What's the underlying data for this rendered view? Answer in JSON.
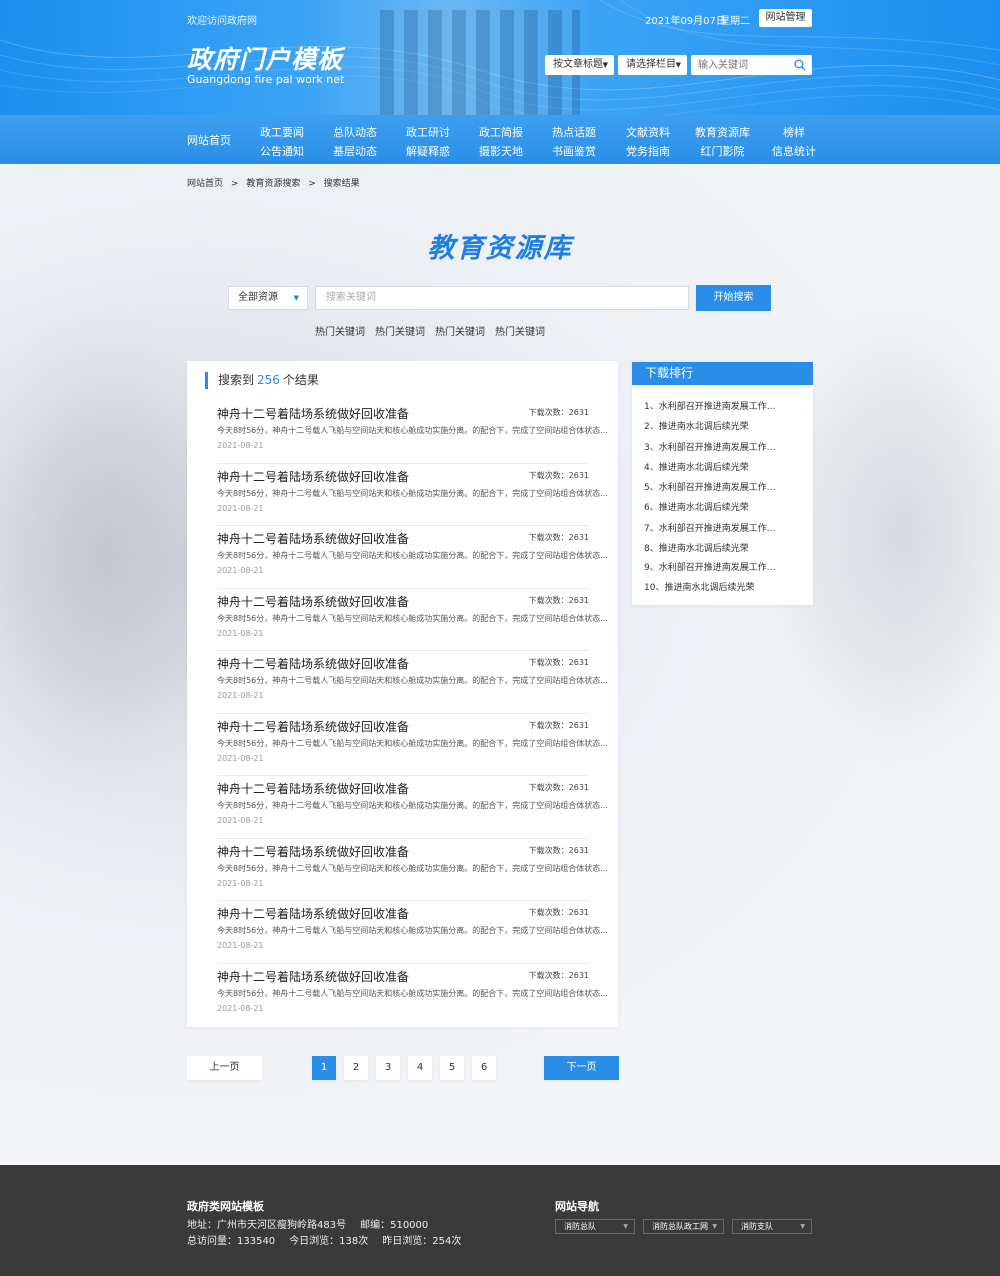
{
  "header": {
    "welcome": "欢迎访问政府网",
    "date": "2021年09月07日",
    "weekday": "星期二",
    "admin_label": "网站管理",
    "logo_title": "政府门户模板",
    "logo_sub": "Guangdong fire pal work net",
    "select1": "按文章标题",
    "select2": "请选择栏目",
    "search_placeholder": "输入关键词"
  },
  "nav": {
    "home": "网站首页",
    "columns": [
      [
        "政工要闻",
        "公告通知"
      ],
      [
        "总队动态",
        "基层动态"
      ],
      [
        "政工研讨",
        "解疑释惑"
      ],
      [
        "政工简报",
        "摄影天地"
      ],
      [
        "热点话题",
        "书画鉴赏"
      ],
      [
        "文献资料",
        "党务指南"
      ],
      [
        "教育资源库",
        "红门影院"
      ],
      [
        "榜样",
        "信息统计"
      ]
    ]
  },
  "breadcrumb": [
    "网站首页",
    ">",
    "教育资源搜索",
    ">",
    "搜索结果"
  ],
  "main": {
    "title": "教育资源库",
    "resource_select": "全部资源",
    "search_placeholder": "搜索关键词",
    "search_button": "开始搜索",
    "hot_keywords": [
      "热门关键词",
      "热门关键词",
      "热门关键词",
      "热门关键词"
    ]
  },
  "results": {
    "prefix": "搜索到",
    "count": "256",
    "suffix": "个结果",
    "items": [
      {
        "title": "神舟十二号着陆场系统做好回收准备",
        "downloads": "下载次数：2631",
        "summary": "今天8时56分，神舟十二号载人飞船与空间站天和核心舱成功实施分离。的配合下，完成了空间站组合体状态...",
        "date": "2021-08-21"
      },
      {
        "title": "神舟十二号着陆场系统做好回收准备",
        "downloads": "下载次数：2631",
        "summary": "今天8时56分，神舟十二号载人飞船与空间站天和核心舱成功实施分离。的配合下，完成了空间站组合体状态...",
        "date": "2021-08-21"
      },
      {
        "title": "神舟十二号着陆场系统做好回收准备",
        "downloads": "下载次数：2631",
        "summary": "今天8时56分，神舟十二号载人飞船与空间站天和核心舱成功实施分离。的配合下，完成了空间站组合体状态...",
        "date": "2021-08-21"
      },
      {
        "title": "神舟十二号着陆场系统做好回收准备",
        "downloads": "下载次数：2631",
        "summary": "今天8时56分，神舟十二号载人飞船与空间站天和核心舱成功实施分离。的配合下，完成了空间站组合体状态...",
        "date": "2021-08-21"
      },
      {
        "title": "神舟十二号着陆场系统做好回收准备",
        "downloads": "下载次数：2631",
        "summary": "今天8时56分，神舟十二号载人飞船与空间站天和核心舱成功实施分离。的配合下，完成了空间站组合体状态...",
        "date": "2021-08-21"
      },
      {
        "title": "神舟十二号着陆场系统做好回收准备",
        "downloads": "下载次数：2631",
        "summary": "今天8时56分，神舟十二号载人飞船与空间站天和核心舱成功实施分离。的配合下，完成了空间站组合体状态...",
        "date": "2021-08-21"
      },
      {
        "title": "神舟十二号着陆场系统做好回收准备",
        "downloads": "下载次数：2631",
        "summary": "今天8时56分，神舟十二号载人飞船与空间站天和核心舱成功实施分离。的配合下，完成了空间站组合体状态...",
        "date": "2021-08-21"
      },
      {
        "title": "神舟十二号着陆场系统做好回收准备",
        "downloads": "下载次数：2631",
        "summary": "今天8时56分，神舟十二号载人飞船与空间站天和核心舱成功实施分离。的配合下，完成了空间站组合体状态...",
        "date": "2021-08-21"
      },
      {
        "title": "神舟十二号着陆场系统做好回收准备",
        "downloads": "下载次数：2631",
        "summary": "今天8时56分，神舟十二号载人飞船与空间站天和核心舱成功实施分离。的配合下，完成了空间站组合体状态...",
        "date": "2021-08-21"
      },
      {
        "title": "神舟十二号着陆场系统做好回收准备",
        "downloads": "下载次数：2631",
        "summary": "今天8时56分，神舟十二号载人飞船与空间站天和核心舱成功实施分离。的配合下，完成了空间站组合体状态...",
        "date": "2021-08-21"
      }
    ]
  },
  "ranking": {
    "title": "下载排行",
    "items": [
      "1、水利部召开推进南发展工作...",
      "2、推进南水北调后续光荣",
      "3、水利部召开推进南发展工作...",
      "4、推进南水北调后续光荣",
      "5、水利部召开推进南发展工作...",
      "6、推进南水北调后续光荣",
      "7、水利部召开推进南发展工作...",
      "8、推进南水北调后续光荣",
      "9、水利部召开推进南发展工作...",
      "10、推进南水北调后续光荣"
    ]
  },
  "pager": {
    "prev": "上一页",
    "next": "下一页",
    "pages": [
      "1",
      "2",
      "3",
      "4",
      "5",
      "6"
    ],
    "current": "1"
  },
  "footer": {
    "title": "政府类网站模板",
    "address_label": "地址：广州市天河区瘦狗岭路483号",
    "postcode": "邮编：510000",
    "total_visits": "总访问量：133540",
    "today_views": "今日浏览：138次",
    "yesterday_views": "昨日浏览：254次",
    "nav_title": "网站导航",
    "nav_selects": [
      "消防总队",
      "消防总队政工网",
      "消防支队"
    ]
  },
  "colors": {
    "accent": "#2a8ee8",
    "title_blue": "#1e7fe0",
    "footer_bg": "#3a3a3a"
  }
}
